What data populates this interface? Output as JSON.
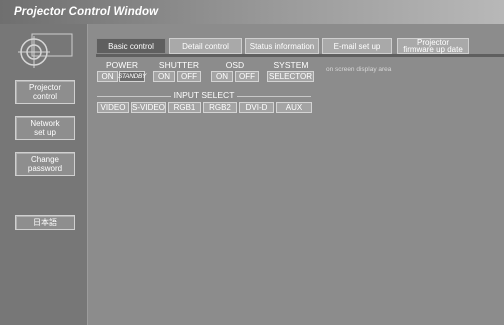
{
  "window": {
    "title": "Projector Control Window"
  },
  "sidebar": {
    "items": [
      {
        "label_lines": [
          "Projector",
          "control"
        ]
      },
      {
        "label_lines": [
          "Network",
          "set up"
        ]
      },
      {
        "label_lines": [
          "Change",
          "password"
        ]
      },
      {
        "label_lines": [
          "日本語"
        ]
      }
    ]
  },
  "tabs": [
    {
      "label": "Basic control",
      "active": true
    },
    {
      "label": "Detail control"
    },
    {
      "label": "Status information"
    },
    {
      "label": "E-mail set up"
    },
    {
      "label_lines": [
        "Projector",
        "firmware up date"
      ]
    }
  ],
  "controls": {
    "power": {
      "label": "POWER",
      "on": "ON",
      "standby": "STANDBY"
    },
    "shutter": {
      "label": "SHUTTER",
      "on": "ON",
      "off": "OFF"
    },
    "osd": {
      "label": "OSD",
      "on": "ON",
      "off": "OFF"
    },
    "system": {
      "label": "SYSTEM",
      "selector": "SELECTOR"
    },
    "osd_note": "on screen display area",
    "input_select": {
      "label": "INPUT SELECT",
      "inputs": [
        "VIDEO",
        "S-VIDEO",
        "RGB1",
        "RGB2",
        "DVI-D",
        "AUX"
      ]
    }
  },
  "colors": {
    "active_tab": "#5f5f5f",
    "inactive_tab": "#a9a9a9",
    "background": "#8c8c8c"
  }
}
